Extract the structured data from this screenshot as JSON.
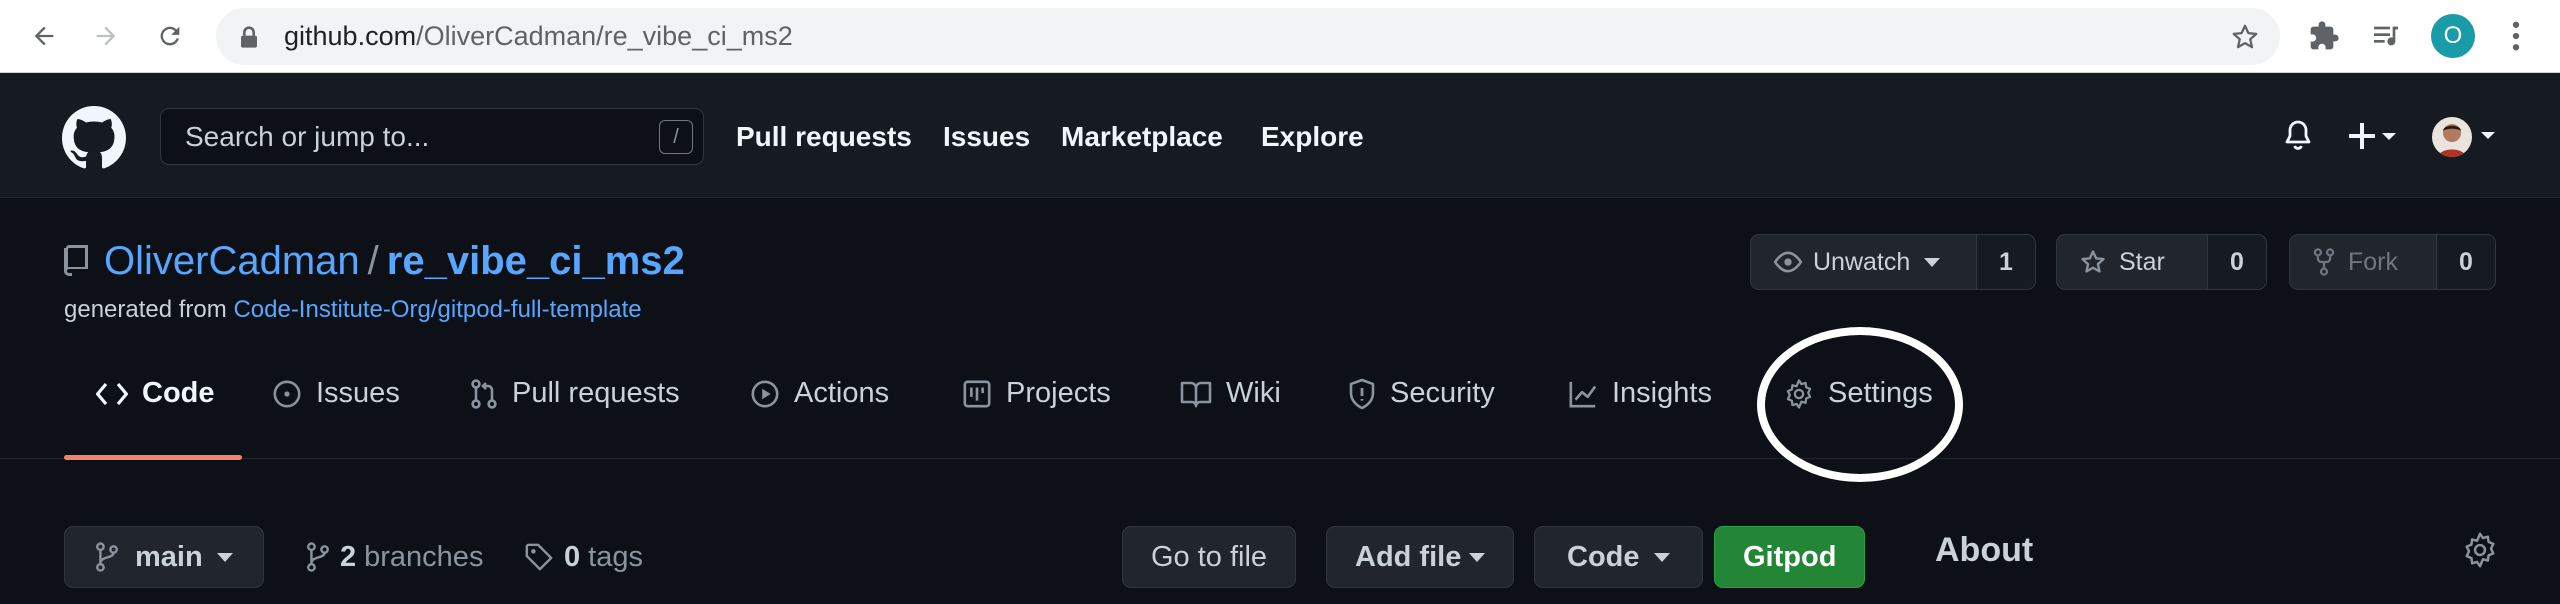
{
  "browser": {
    "url_host": "github.com",
    "url_path": "/OliverCadman/re_vibe_ci_ms2",
    "profile_initial": "O"
  },
  "header": {
    "search_placeholder": "Search or jump to...",
    "search_shortcut": "/",
    "nav": [
      "Pull requests",
      "Issues",
      "Marketplace",
      "Explore"
    ]
  },
  "repo": {
    "owner": "OliverCadman",
    "separator": "/",
    "name": "re_vibe_ci_ms2",
    "generated_prefix": "generated from",
    "generated_link": "Code-Institute-Org/gitpod-full-template",
    "watch_label": "Unwatch",
    "watch_count": "1",
    "star_label": "Star",
    "star_count": "0",
    "fork_label": "Fork",
    "fork_count": "0"
  },
  "tabs": [
    {
      "label": "Code",
      "icon": "code-icon",
      "active": true
    },
    {
      "label": "Issues",
      "icon": "issue-icon"
    },
    {
      "label": "Pull requests",
      "icon": "pull-request-icon"
    },
    {
      "label": "Actions",
      "icon": "play-icon"
    },
    {
      "label": "Projects",
      "icon": "project-icon"
    },
    {
      "label": "Wiki",
      "icon": "book-icon"
    },
    {
      "label": "Security",
      "icon": "shield-icon"
    },
    {
      "label": "Insights",
      "icon": "graph-icon"
    },
    {
      "label": "Settings",
      "icon": "gear-icon"
    }
  ],
  "toolbar": {
    "branch": "main",
    "branches_count": "2",
    "branches_label": "branches",
    "tags_count": "0",
    "tags_label": "tags",
    "go_to_file": "Go to file",
    "add_file": "Add file",
    "code": "Code",
    "gitpod": "Gitpod",
    "about": "About"
  },
  "colors": {
    "accent_link": "#58a6ff",
    "tab_underline": "#f78166",
    "gitpod_green": "#238636"
  }
}
